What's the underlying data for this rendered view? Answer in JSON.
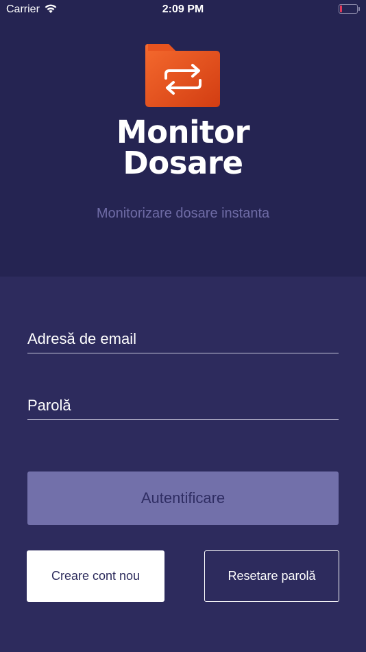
{
  "status_bar": {
    "carrier": "Carrier",
    "time": "2:09 PM",
    "battery_level": 0.1,
    "battery_color": "#e0395b"
  },
  "logo": {
    "icon": "folder-sync-icon",
    "colors": [
      "#f3602a",
      "#ce3a12"
    ]
  },
  "brand": {
    "line1": "Monitor",
    "line2": "Dosare"
  },
  "tagline": "Monitorizare dosare instanta",
  "form": {
    "email_placeholder": "Adresă de email",
    "email_value": "",
    "password_placeholder": "Parolă",
    "password_value": ""
  },
  "buttons": {
    "login_label": "Autentificare",
    "create_account_label": "Creare cont nou",
    "reset_password_label": "Resetare parolă"
  },
  "colors": {
    "header_bg": "#252452",
    "body_bg": "#2d2b5d",
    "login_button": "#7270aa",
    "tagline": "#6f6ca6"
  }
}
